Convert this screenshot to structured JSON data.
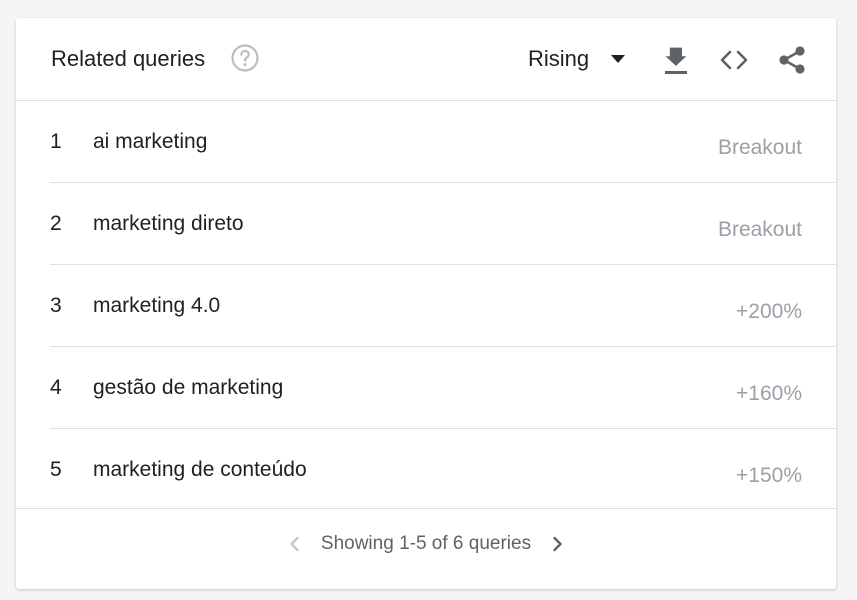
{
  "header": {
    "title": "Related queries",
    "dropdown_selected": "Rising"
  },
  "rows": [
    {
      "index": "1",
      "query": "ai marketing",
      "value": "Breakout"
    },
    {
      "index": "2",
      "query": "marketing direto",
      "value": "Breakout"
    },
    {
      "index": "3",
      "query": "marketing 4.0",
      "value": "+200%"
    },
    {
      "index": "4",
      "query": "gestão de marketing",
      "value": "+160%"
    },
    {
      "index": "5",
      "query": "marketing de conteúdo",
      "value": "+150%"
    }
  ],
  "footer": {
    "pager_text": "Showing 1-5 of 6 queries"
  },
  "icons": {
    "help": "help-circle-icon",
    "caret": "caret-down-icon",
    "download": "download-icon",
    "embed": "code-embed-icon",
    "share": "share-icon",
    "prev": "chevron-left-icon",
    "next": "chevron-right-icon"
  },
  "colors": {
    "text": "#202124",
    "muted": "#9aa0a6",
    "icon": "#5f6368",
    "divider": "#e0e0e0"
  }
}
